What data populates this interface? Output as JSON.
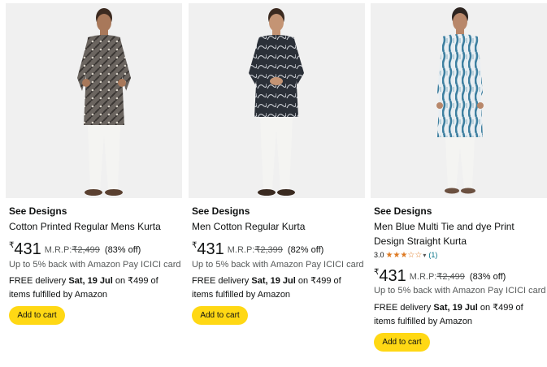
{
  "products": [
    {
      "brand": "See Designs",
      "title": "Cotton Printed Regular Mens Kurta",
      "currency_symbol": "₹",
      "price": "431",
      "mrp_label": "M.R.P:",
      "mrp": "₹2,499",
      "discount": "(83% off)",
      "cashback": "Up to 5% back with Amazon Pay ICICI card",
      "delivery_prefix": "FREE delivery",
      "delivery_date": "Sat, 19 Jul",
      "delivery_suffix": "on ₹499 of items fulfilled by Amazon",
      "add_to_cart": "Add to cart",
      "kurta_color": "#6b6560",
      "kurta_pattern": "#3a3633"
    },
    {
      "brand": "See Designs",
      "title": "Men Cotton Regular Kurta",
      "currency_symbol": "₹",
      "price": "431",
      "mrp_label": "M.R.P:",
      "mrp": "₹2,399",
      "discount": "(82% off)",
      "cashback": "Up to 5% back with Amazon Pay ICICI card",
      "delivery_prefix": "FREE delivery",
      "delivery_date": "Sat, 19 Jul",
      "delivery_suffix": "on ₹499 of items fulfilled by Amazon",
      "add_to_cart": "Add to cart",
      "kurta_color": "#2b3038",
      "kurta_pattern": "#c9ccd2"
    },
    {
      "brand": "See Designs",
      "title": "Men Blue Multi Tie and dye Print Design Straight Kurta",
      "rating": "3.0",
      "stars": "★★★☆☆",
      "rating_count": "(1)",
      "currency_symbol": "₹",
      "price": "431",
      "mrp_label": "M.R.P:",
      "mrp": "₹2,499",
      "discount": "(83% off)",
      "cashback": "Up to 5% back with Amazon Pay ICICI card",
      "delivery_prefix": "FREE delivery",
      "delivery_date": "Sat, 19 Jul",
      "delivery_suffix": "on ₹499 of items fulfilled by Amazon",
      "add_to_cart": "Add to cart",
      "kurta_color": "#3d7fa0",
      "kurta_pattern": "#e8eef2"
    }
  ],
  "colors": {
    "button_yellow": "#ffd814",
    "star_orange": "#de7921",
    "link_teal": "#007185",
    "muted_text": "#565959",
    "image_bg": "#f0f0f0"
  }
}
